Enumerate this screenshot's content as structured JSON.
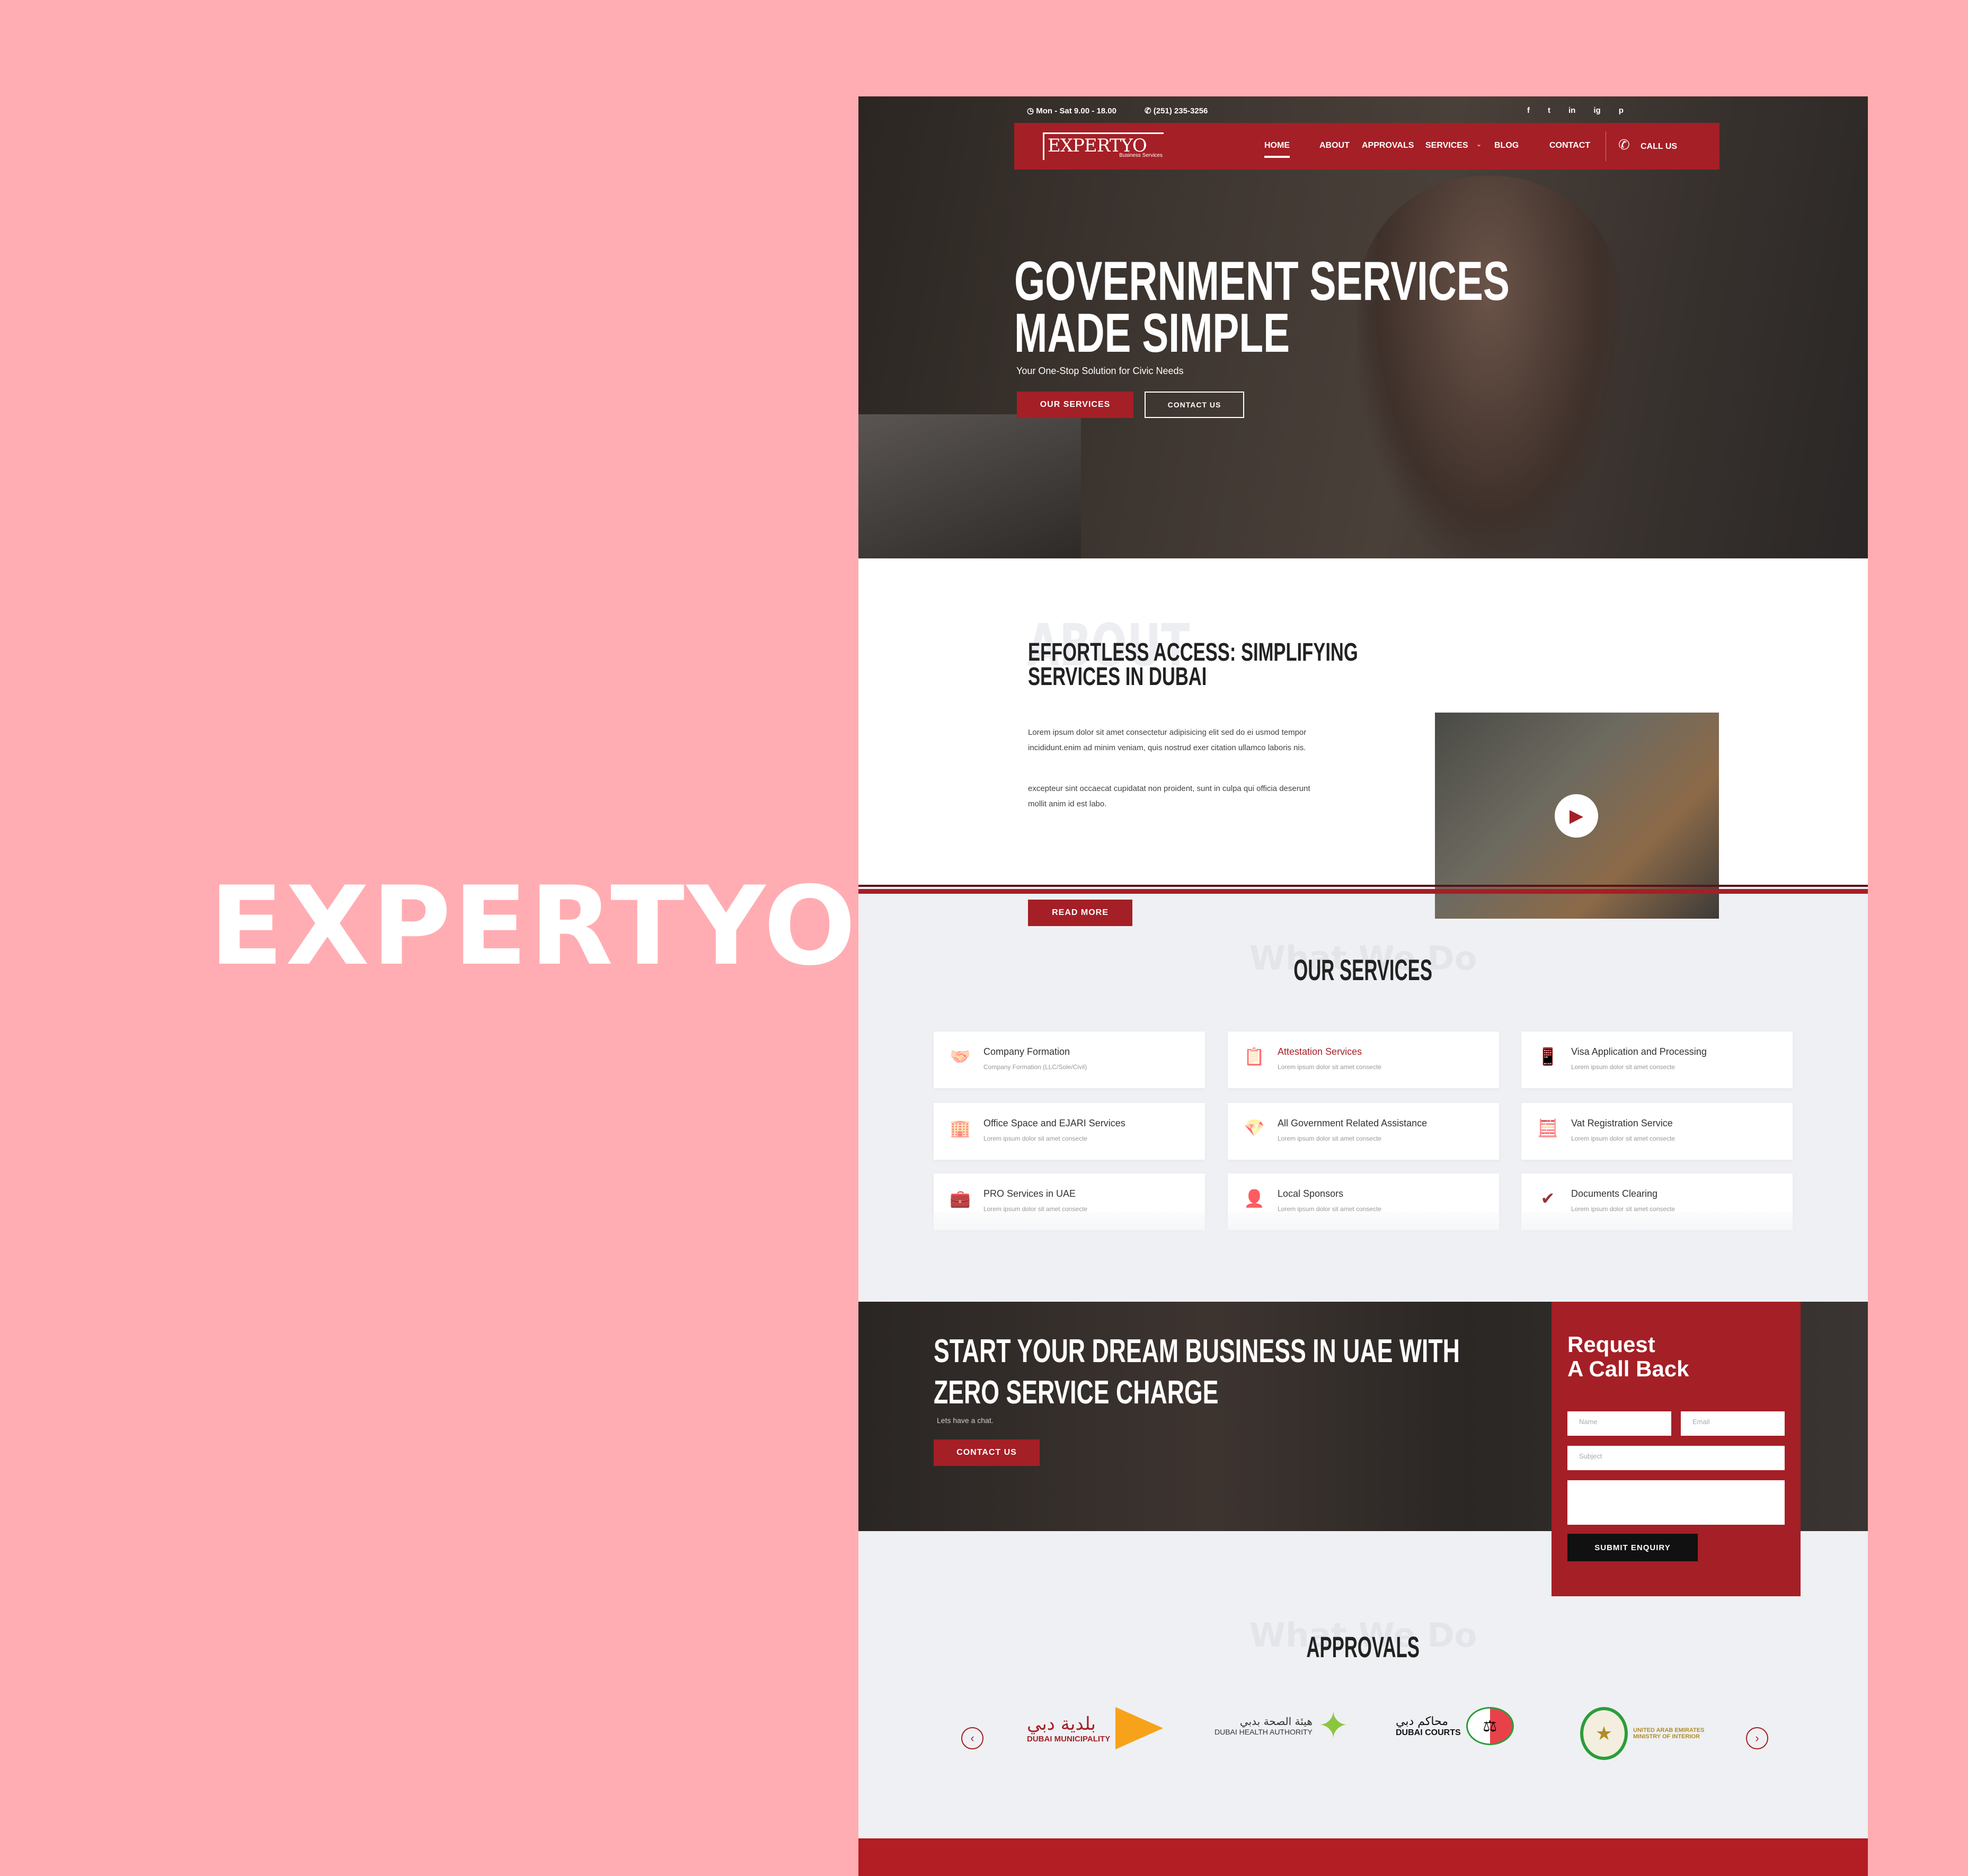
{
  "brand": "EXPERTYO",
  "topbar": {
    "hours": "Mon - Sat 9.00 - 18.00",
    "phone": "(251) 235-3256",
    "social": [
      "f",
      "t",
      "in",
      "ig",
      "p"
    ]
  },
  "nav": {
    "logo": "EXPERTYO",
    "logo_sub": "Business Services",
    "items": [
      "HOME",
      "ABOUT",
      "APPROVALS",
      "SERVICES",
      "BLOG",
      "CONTACT"
    ],
    "call": "CALL US"
  },
  "hero": {
    "title1": "GOVERNMENT SERVICES",
    "title2": "MADE SIMPLE",
    "subtitle": "Your One-Stop Solution for Civic Needs",
    "btn1": "OUR SERVICES",
    "btn2": "CONTACT US"
  },
  "about": {
    "ghost": "ABOUT",
    "title1": "EFFORTLESS ACCESS: SIMPLIFYING",
    "title2": "SERVICES IN DUBAI",
    "p1": "Lorem ipsum dolor sit amet consectetur adipisicing elit sed do ei usmod tempor incididunt.enim ad minim veniam, quis nostrud exer citation ullamco laboris nis.",
    "p2": "excepteur sint occaecat cupidatat non proident, sunt in culpa qui officia deserunt mollit anim id est labo.",
    "btn": "READ MORE"
  },
  "services": {
    "ghost": "What We Do",
    "title": "OUR SERVICES",
    "items": [
      {
        "title": "Company Formation",
        "desc": "Company Formation (LLC/Sole/Civil)",
        "icon": "handshake"
      },
      {
        "title": "Attestation Services",
        "desc": "Lorem ipsum dolor sit amet consecte",
        "icon": "clipboard"
      },
      {
        "title": "Visa Application and Processing",
        "desc": "Lorem ipsum dolor sit amet consecte",
        "icon": "mobile-id"
      },
      {
        "title": "Office Space and EJARI Services",
        "desc": "Lorem ipsum dolor sit amet consecte",
        "icon": "building"
      },
      {
        "title": "All Government Related Assistance",
        "desc": "Lorem ipsum dolor sit amet consecte",
        "icon": "diamond"
      },
      {
        "title": "Vat Registration Service",
        "desc": "Lorem ipsum dolor sit amet consecte",
        "icon": "calculator"
      },
      {
        "title": "PRO Services in UAE",
        "desc": "Lorem ipsum dolor sit amet consecte",
        "icon": "person-briefcase"
      },
      {
        "title": "Local Sponsors",
        "desc": "Lorem ipsum dolor sit amet consecte",
        "icon": "person-pin"
      },
      {
        "title": "Documents Clearing",
        "desc": "Lorem ipsum dolor sit amet consecte",
        "icon": "checklist"
      }
    ]
  },
  "cta": {
    "title1": "START YOUR DREAM BUSINESS IN UAE WITH",
    "title2": "ZERO SERVICE CHARGE",
    "sub": "Lets have a chat.",
    "btn": "CONTACT US"
  },
  "form": {
    "title1": "Request",
    "title2": "A Call Back",
    "name": "Name",
    "email": "Email",
    "subject": "Subject",
    "submit": "SUBMIT ENQUIRY"
  },
  "approvals": {
    "ghost": "What We Do",
    "title": "APPROVALS",
    "logos": [
      {
        "ar": "بلدية دبي",
        "en": "DUBAI MUNICIPALITY"
      },
      {
        "ar": "هيئة الصحة بدبي",
        "en": "DUBAI HEALTH AUTHORITY"
      },
      {
        "ar": "محاكم دبي",
        "en": "DUBAI COURTS"
      },
      {
        "ar": "",
        "en": "UNITED ARAB EMIRATES MINISTRY OF INTERIOR"
      }
    ]
  },
  "colors": {
    "accent": "#a51f26",
    "background": "#ffadb2"
  }
}
